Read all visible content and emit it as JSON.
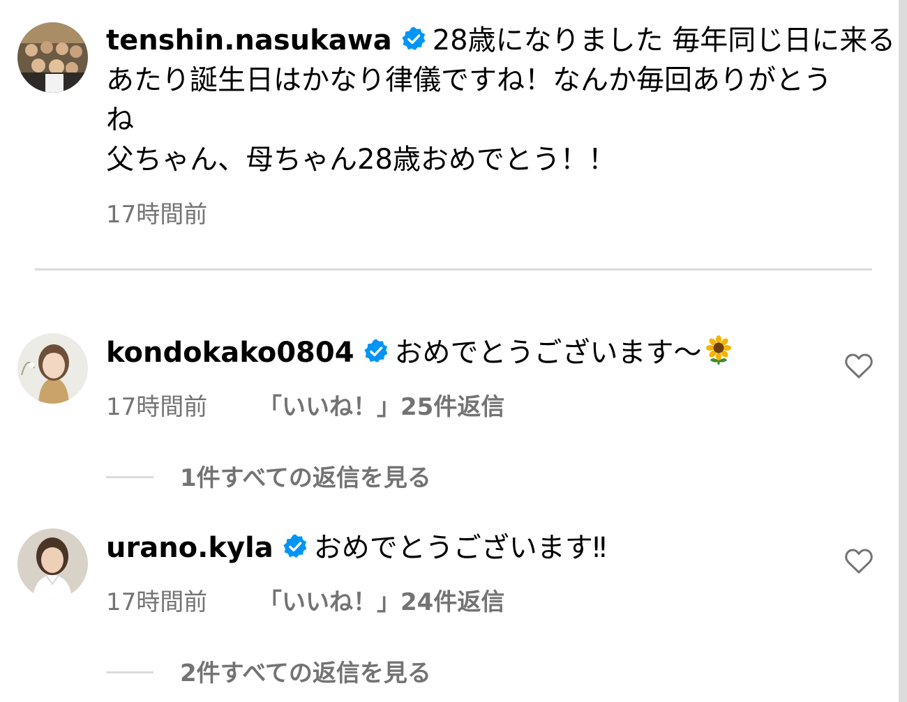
{
  "caption": {
    "username": "tenshin.nasukawa",
    "line1": "28歳になりました 毎年同じ日に来る",
    "line2": "あたり誕生日はかなり律儀ですね！なんか毎回ありがとう",
    "line3": "ね",
    "line4": "父ちゃん、母ちゃん28歳おめでとう！！",
    "time": "17時間前"
  },
  "comments": [
    {
      "username": "kondokako0804",
      "text": "おめでとうございます〜",
      "emoji": "sunflower-emoji",
      "time": "17時間前",
      "likes": "「いいね！」25件",
      "reply": "返信",
      "view_replies": "1件すべての返信を見る"
    },
    {
      "username": "urano.kyla",
      "text": "おめでとうございます‼︎",
      "time": "17時間前",
      "likes": "「いいね！」24件",
      "reply": "返信",
      "view_replies": "2件すべての返信を見る"
    }
  ],
  "colors": {
    "verified": "#0095f6",
    "secondary_text": "#737373",
    "divider": "#dbdbdb"
  }
}
